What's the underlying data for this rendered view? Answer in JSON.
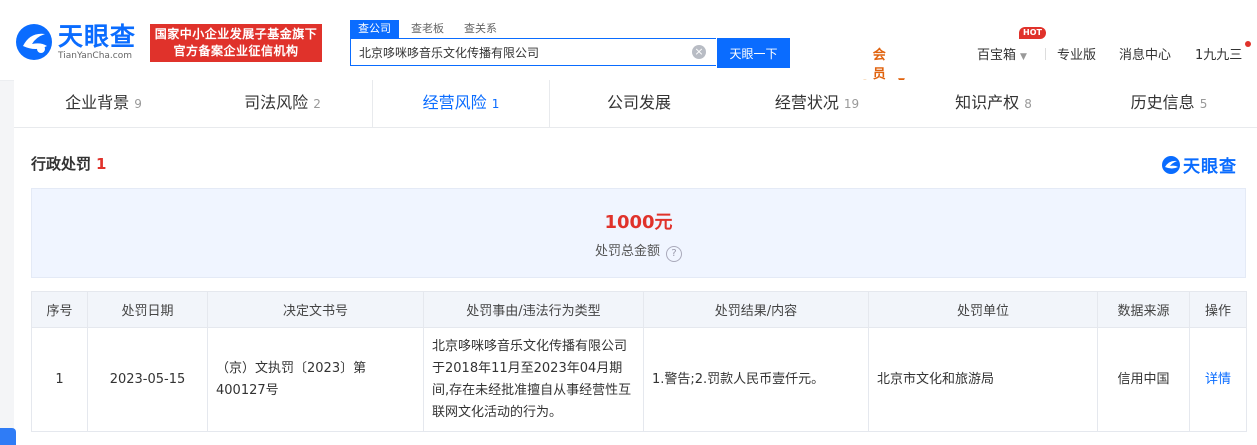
{
  "header": {
    "logo_name": "天眼查",
    "logo_sub": "TianYanCha.com",
    "slogan_line1": "国家中小企业发展子基金旗下",
    "slogan_line2": "官方备案企业征信机构",
    "search_tabs": [
      "查公司",
      "查老板",
      "查关系"
    ],
    "search_value": "北京哆咪哆音乐文化传播有限公司",
    "search_button": "天眼一下",
    "nav": {
      "vip": "会员服务",
      "treasure": "百宝箱",
      "hot": "HOT",
      "pro": "专业版",
      "messages": "消息中心",
      "user": "1九九三"
    }
  },
  "tabs": [
    {
      "label": "企业背景",
      "count": "9"
    },
    {
      "label": "司法风险",
      "count": "2"
    },
    {
      "label": "经营风险",
      "count": "1"
    },
    {
      "label": "公司发展",
      "count": ""
    },
    {
      "label": "经营状况",
      "count": "19"
    },
    {
      "label": "知识产权",
      "count": "8"
    },
    {
      "label": "历史信息",
      "count": "5"
    }
  ],
  "section": {
    "title": "行政处罚",
    "count": "1",
    "brand": "天眼查"
  },
  "summary": {
    "amount": "1000元",
    "label": "处罚总金额"
  },
  "table": {
    "headers": [
      "序号",
      "处罚日期",
      "决定文书号",
      "处罚事由/违法行为类型",
      "处罚结果/内容",
      "处罚单位",
      "数据来源",
      "操作"
    ],
    "rows": [
      {
        "index": "1",
        "date": "2023-05-15",
        "doc_no": "（京）文执罚〔2023〕第400127号",
        "reason": "北京哆咪哆音乐文化传播有限公司于2018年11月至2023年04月期间,存在未经批准擅自从事经营性互联网文化活动的行为。",
        "result": "1.警告;2.罚款人民币壹仟元。",
        "authority": "北京市文化和旅游局",
        "source": "信用中国",
        "action": "详情"
      }
    ]
  },
  "colors": {
    "brand_blue": "#0a6cff",
    "alert_red": "#e0322b",
    "vip_orange": "#e0620d"
  }
}
